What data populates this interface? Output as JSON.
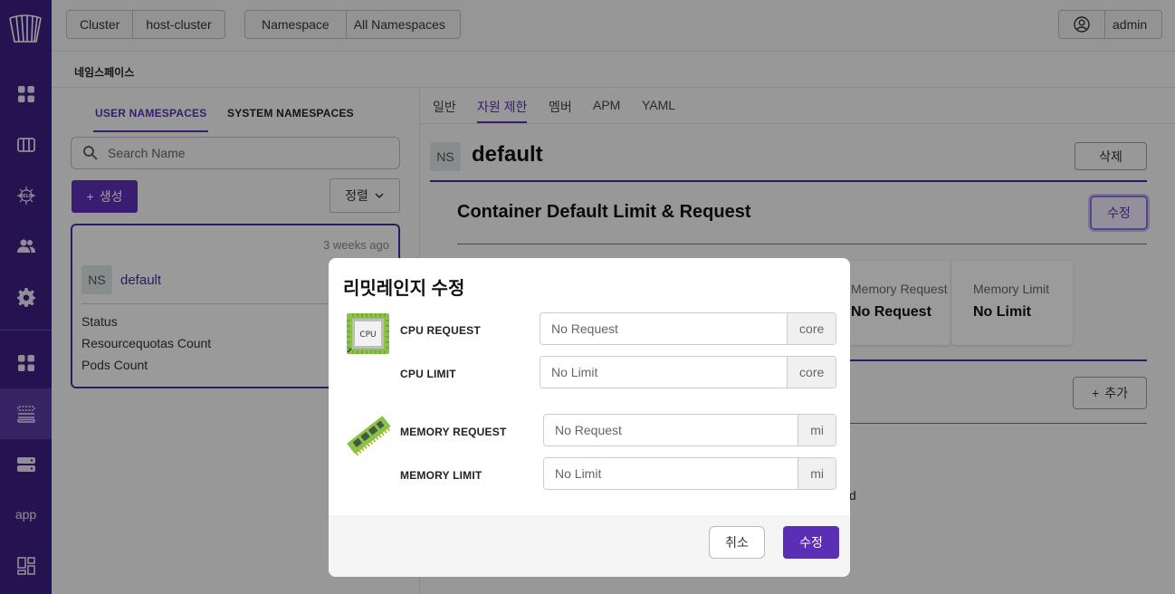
{
  "topbar": {
    "cluster_label": "Cluster",
    "cluster_value": "host-cluster",
    "namespace_label": "Namespace",
    "namespace_value": "All Namespaces",
    "user": "admin"
  },
  "sidebar": {
    "app_label": "app"
  },
  "breadcrumb": "네임스페이스",
  "left": {
    "tabs": [
      "USER NAMESPACES",
      "SYSTEM NAMESPACES"
    ],
    "search_placeholder": "Search Name",
    "create_label": "생성",
    "sort_label": "정렬",
    "card": {
      "time": "3 weeks ago",
      "badge": "NS",
      "name": "default",
      "rows": [
        "Status",
        "Resourcequotas Count",
        "Pods Count"
      ]
    }
  },
  "right": {
    "tabs": [
      "일반",
      "자원 제한",
      "멤버",
      "APM",
      "YAML"
    ],
    "badge": "NS",
    "title": "default",
    "delete_label": "삭제",
    "section_title": "Container Default Limit & Request",
    "edit_label": "수정",
    "stat1_label": "Memory Request",
    "stat1_value": "No Request",
    "stat2_label": "Memory Limit",
    "stat2_value": "No Limit",
    "add_label": "추가",
    "partial_text": "d"
  },
  "modal": {
    "title": "리밋레인지 수정",
    "cpu_chip_label": "CPU",
    "cpu_request_label": "CPU REQUEST",
    "cpu_request_placeholder": "No Request",
    "cpu_request_unit": "core",
    "cpu_limit_label": "CPU LIMIT",
    "cpu_limit_placeholder": "No Limit",
    "cpu_limit_unit": "core",
    "memory_request_label": "MEMORY REQUEST",
    "memory_request_placeholder": "No Request",
    "memory_request_unit": "mi",
    "memory_limit_label": "MEMORY LIMIT",
    "memory_limit_placeholder": "No Limit",
    "memory_limit_unit": "mi",
    "cancel_label": "취소",
    "submit_label": "수정"
  }
}
